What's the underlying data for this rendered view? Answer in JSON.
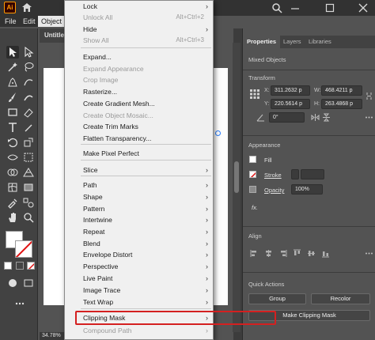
{
  "app": {
    "logo_text": "Ai"
  },
  "menubar": {
    "items": [
      "File",
      "Edit",
      "Object"
    ]
  },
  "document": {
    "tab_title": "Untitle",
    "zoom": "34.78%"
  },
  "object_menu": {
    "items": [
      {
        "label": "Lock",
        "submenu": true,
        "disabled": false
      },
      {
        "label": "Unlock All",
        "shortcut": "Alt+Ctrl+2",
        "disabled": true
      },
      {
        "label": "Hide",
        "submenu": true,
        "disabled": false
      },
      {
        "label": "Show All",
        "shortcut": "Alt+Ctrl+3",
        "disabled": true
      },
      {
        "label": "Expand...",
        "disabled": false
      },
      {
        "label": "Expand Appearance",
        "disabled": true
      },
      {
        "label": "Crop Image",
        "disabled": true
      },
      {
        "label": "Rasterize...",
        "disabled": false
      },
      {
        "label": "Create Gradient Mesh...",
        "disabled": false
      },
      {
        "label": "Create Object Mosaic...",
        "disabled": true
      },
      {
        "label": "Create Trim Marks",
        "disabled": false
      },
      {
        "label": "Flatten Transparency...",
        "disabled": false
      },
      {
        "label": "Make Pixel Perfect",
        "disabled": false
      },
      {
        "label": "Slice",
        "submenu": true,
        "disabled": false
      },
      {
        "label": "Path",
        "submenu": true,
        "disabled": false
      },
      {
        "label": "Shape",
        "submenu": true,
        "disabled": false
      },
      {
        "label": "Pattern",
        "submenu": true,
        "disabled": false
      },
      {
        "label": "Intertwine",
        "submenu": true,
        "disabled": false
      },
      {
        "label": "Repeat",
        "submenu": true,
        "disabled": false
      },
      {
        "label": "Blend",
        "submenu": true,
        "disabled": false
      },
      {
        "label": "Envelope Distort",
        "submenu": true,
        "disabled": false
      },
      {
        "label": "Perspective",
        "submenu": true,
        "disabled": false
      },
      {
        "label": "Live Paint",
        "submenu": true,
        "disabled": false
      },
      {
        "label": "Image Trace",
        "submenu": true,
        "disabled": false
      },
      {
        "label": "Text Wrap",
        "submenu": true,
        "disabled": false
      },
      {
        "label": "Clipping Mask",
        "submenu": true,
        "disabled": false,
        "highlighted": true
      },
      {
        "label": "Compound Path",
        "submenu": true,
        "disabled": true
      }
    ]
  },
  "properties": {
    "tabs": [
      "Properties",
      "Layers",
      "Libraries"
    ],
    "selection_type": "Mixed Objects",
    "transform": {
      "title": "Transform",
      "x_label": "X:",
      "x_value": "311.2632 p",
      "y_label": "Y:",
      "y_value": "220.5614 p",
      "w_label": "W:",
      "w_value": "468.4211 p",
      "h_label": "H:",
      "h_value": "263.4868 p",
      "angle_value": "0°"
    },
    "appearance": {
      "title": "Appearance",
      "fill_label": "Fill",
      "stroke_label": "Stroke",
      "opacity_label": "Opacity",
      "opacity_value": "100%",
      "fx_label": "fx."
    },
    "align": {
      "title": "Align"
    },
    "quick_actions": {
      "title": "Quick Actions",
      "group_label": "Group",
      "recolor_label": "Recolor",
      "clipping_label": "Make Clipping Mask"
    }
  },
  "colors": {
    "accent_highlight": "#d42020",
    "menu_bg": "#f0f0f0",
    "panel_bg": "#535353",
    "app_bar": "#323232"
  }
}
